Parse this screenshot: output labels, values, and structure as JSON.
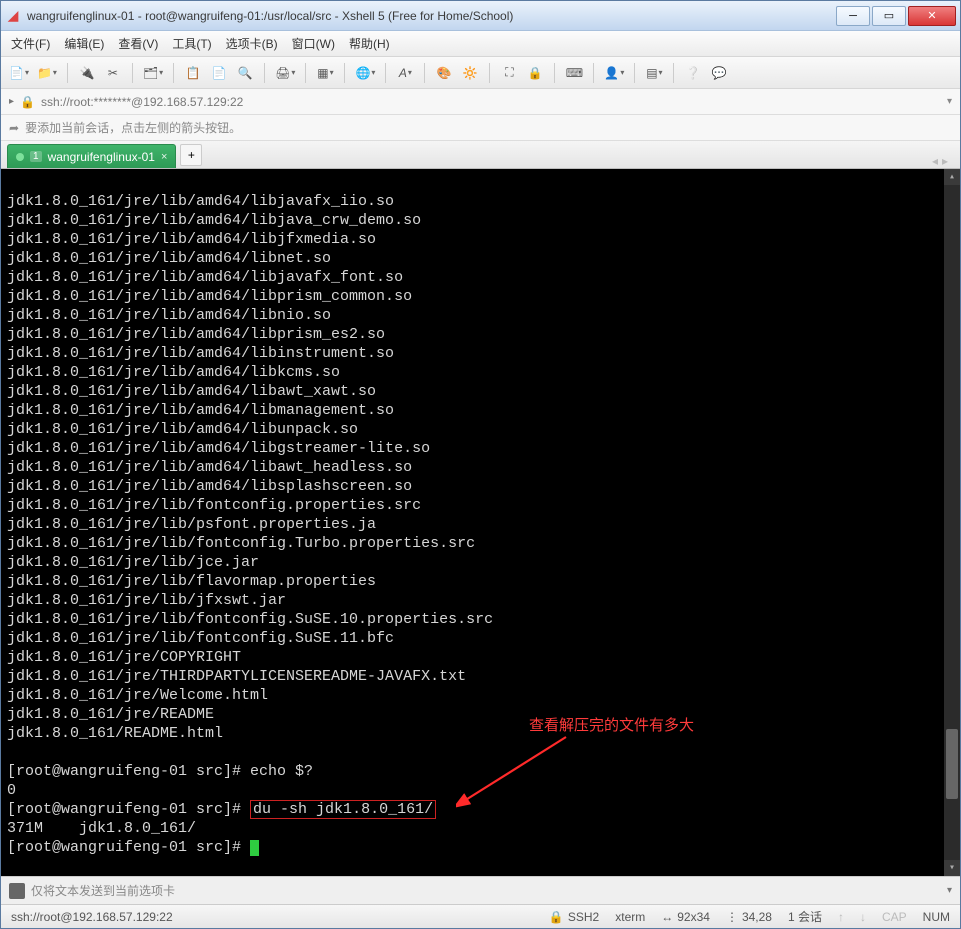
{
  "window": {
    "title": "wangruifenglinux-01 - root@wangruifeng-01:/usr/local/src - Xshell 5 (Free for Home/School)"
  },
  "menu": {
    "file": "文件(F)",
    "edit": "编辑(E)",
    "view": "查看(V)",
    "tools": "工具(T)",
    "tab": "选项卡(B)",
    "window": "窗口(W)",
    "help": "帮助(H)"
  },
  "address": {
    "text": "ssh://root:********@192.168.57.129:22"
  },
  "hint": {
    "text": "要添加当前会话，点击左侧的箭头按钮。"
  },
  "tab1": {
    "num": "1",
    "label": "wangruifenglinux-01"
  },
  "terminal": {
    "lines": [
      "jdk1.8.0_161/jre/lib/amd64/libjavafx_iio.so",
      "jdk1.8.0_161/jre/lib/amd64/libjava_crw_demo.so",
      "jdk1.8.0_161/jre/lib/amd64/libjfxmedia.so",
      "jdk1.8.0_161/jre/lib/amd64/libnet.so",
      "jdk1.8.0_161/jre/lib/amd64/libjavafx_font.so",
      "jdk1.8.0_161/jre/lib/amd64/libprism_common.so",
      "jdk1.8.0_161/jre/lib/amd64/libnio.so",
      "jdk1.8.0_161/jre/lib/amd64/libprism_es2.so",
      "jdk1.8.0_161/jre/lib/amd64/libinstrument.so",
      "jdk1.8.0_161/jre/lib/amd64/libkcms.so",
      "jdk1.8.0_161/jre/lib/amd64/libawt_xawt.so",
      "jdk1.8.0_161/jre/lib/amd64/libmanagement.so",
      "jdk1.8.0_161/jre/lib/amd64/libunpack.so",
      "jdk1.8.0_161/jre/lib/amd64/libgstreamer-lite.so",
      "jdk1.8.0_161/jre/lib/amd64/libawt_headless.so",
      "jdk1.8.0_161/jre/lib/amd64/libsplashscreen.so",
      "jdk1.8.0_161/jre/lib/fontconfig.properties.src",
      "jdk1.8.0_161/jre/lib/psfont.properties.ja",
      "jdk1.8.0_161/jre/lib/fontconfig.Turbo.properties.src",
      "jdk1.8.0_161/jre/lib/jce.jar",
      "jdk1.8.0_161/jre/lib/flavormap.properties",
      "jdk1.8.0_161/jre/lib/jfxswt.jar",
      "jdk1.8.0_161/jre/lib/fontconfig.SuSE.10.properties.src",
      "jdk1.8.0_161/jre/lib/fontconfig.SuSE.11.bfc",
      "jdk1.8.0_161/jre/COPYRIGHT",
      "jdk1.8.0_161/jre/THIRDPARTYLICENSEREADME-JAVAFX.txt",
      "jdk1.8.0_161/jre/Welcome.html",
      "jdk1.8.0_161/jre/README",
      "jdk1.8.0_161/README.html"
    ],
    "prompt1_pre": "[root@wangruifeng-01 src]# ",
    "prompt1_cmd": "echo $?",
    "result1": "0",
    "prompt2_pre": "[root@wangruifeng-01 src]# ",
    "prompt2_cmd": "du -sh jdk1.8.0_161/",
    "result2": "371M    jdk1.8.0_161/",
    "prompt3": "[root@wangruifeng-01 src]# ",
    "annotation": "查看解压完的文件有多大"
  },
  "sendbar": {
    "text": "仅将文本发送到当前选项卡"
  },
  "status": {
    "left": "ssh://root@192.168.57.129:22",
    "ssh": "SSH2",
    "term": "xterm",
    "size": "92x34",
    "pos": "34,28",
    "sessions": "1 会话",
    "cap": "CAP",
    "num": "NUM"
  },
  "icons": {
    "lock": "🔒",
    "pin": "📌"
  }
}
